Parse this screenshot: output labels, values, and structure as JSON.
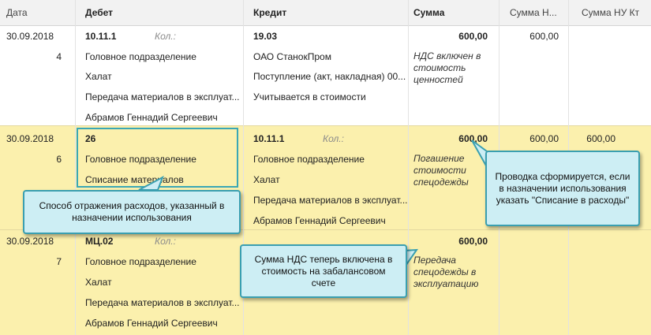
{
  "columns": {
    "date": "Дата",
    "debit": "Дебет",
    "credit": "Кредит",
    "sum": "Сумма",
    "sum_nu_dt": "Сумма Н...",
    "sum_nu_kt": "Сумма НУ Кт"
  },
  "rows": [
    {
      "date": "30.09.2018",
      "num": "4",
      "debit_account": "10.11.1",
      "debit_qty_label": "Кол.:",
      "debit_sub": [
        "Головное подразделение",
        "Халат",
        "Передача материалов в эксплуат...",
        "Абрамов Геннадий Сергеевич"
      ],
      "credit_account": "19.03",
      "credit_sub": [
        "ОАО СтанокПром",
        "Поступление (акт, накладная) 00...",
        "Учитывается в стоимости"
      ],
      "sum": "600,00",
      "content": "НДС включен в стоимость ценностей",
      "sum_nu_dt": "600,00",
      "sum_nu_kt": ""
    },
    {
      "date": "30.09.2018",
      "num": "6",
      "debit_account": "26",
      "debit_sub": [
        "Головное подразделение",
        "Списание материалов"
      ],
      "credit_account": "10.11.1",
      "credit_qty_label": "Кол.:",
      "credit_sub": [
        "Головное подразделение",
        "Халат",
        "Передача материалов в эксплуат...",
        "Абрамов Геннадий Сергеевич"
      ],
      "sum": "600,00",
      "content": "Погашение стоимости спецодежды",
      "sum_nu_dt": "600,00",
      "sum_nu_kt": "600,00"
    },
    {
      "date": "30.09.2018",
      "num": "7",
      "debit_account": "МЦ.02",
      "debit_qty_label": "Кол.:",
      "debit_sub": [
        "Головное подразделение",
        "Халат",
        "Передача материалов в эксплуат...",
        "Абрамов Геннадий Сергеевич"
      ],
      "sum": "600,00",
      "content": "Передача спецодежды в эксплуатацию"
    }
  ],
  "callouts": {
    "left": "Способ отражения расходов, указанный в назначении использования",
    "right": "Проводка сформируется, если в назначении использования указать \"Списание в расходы\"",
    "middle": "Сумма НДС теперь включена в стоимость на забалансовом счете"
  },
  "colors": {
    "highlight_row": "#fbf0ad",
    "callout_bg": "#cdeef4",
    "callout_border": "#3a9fb0"
  }
}
